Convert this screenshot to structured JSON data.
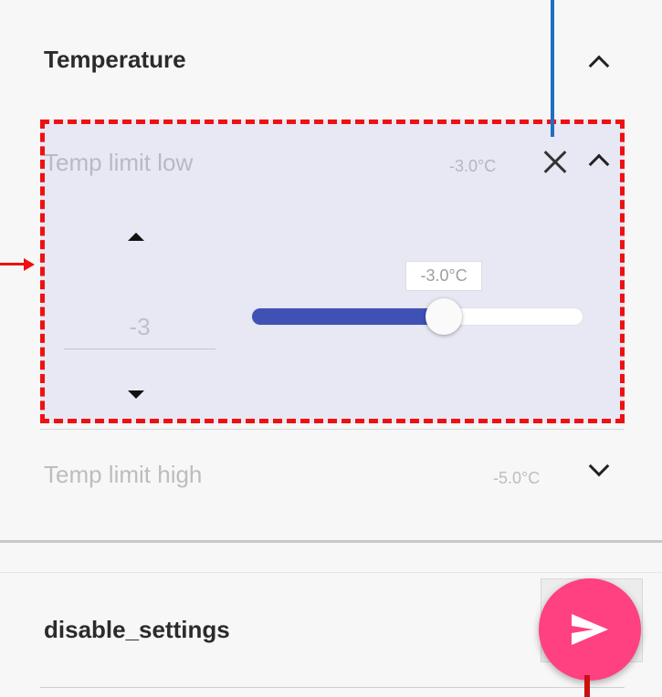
{
  "section": {
    "title": "Temperature",
    "toggle_icon": "chevron-up-icon"
  },
  "temp_low": {
    "label": "Temp limit low",
    "value_text": "-3.0°C",
    "close_icon": "close-icon",
    "toggle_icon": "chevron-up-icon",
    "stepper": {
      "value": "-3",
      "up_icon": "triangle-up-icon",
      "down_icon": "triangle-down-icon"
    },
    "slider": {
      "tooltip": "-3.0°C",
      "level_fraction": 0.58,
      "fill_color": "#3f51b5"
    }
  },
  "temp_high": {
    "label": "Temp limit high",
    "value_text": "-5.0°C",
    "toggle_icon": "chevron-down-icon"
  },
  "bottom": {
    "label": "disable_settings"
  },
  "fab": {
    "icon": "send-icon",
    "color": "#ff4081"
  },
  "annotation_colors": {
    "highlight": "#ee1111",
    "pointer": "#1f6fc2"
  }
}
